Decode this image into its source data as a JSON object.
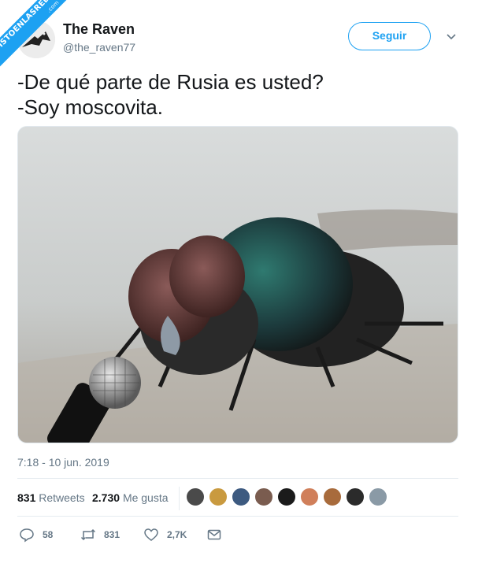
{
  "watermark": {
    "text": "VISTOENLASREDES",
    "sub": ".com"
  },
  "author": {
    "name": "The Raven",
    "handle": "@the_raven77"
  },
  "follow_button": {
    "label": "Seguir"
  },
  "tweet": {
    "line1": "-De qué parte de Rusia es usted?",
    "line2": "-Soy moscovita."
  },
  "timestamp": "7:18 - 10 jun. 2019",
  "stats": {
    "retweets_count": "831",
    "retweets_label": "Retweets",
    "likes_count": "2.730",
    "likes_label": "Me gusta"
  },
  "liker_avatars": [
    "#4a4a4a",
    "#c99a3f",
    "#3d5a80",
    "#7a5c4f",
    "#1b1b1b",
    "#d07f5a",
    "#a86b3c",
    "#2b2b2b",
    "#8a9aa6"
  ],
  "actions": {
    "replies": "58",
    "retweets": "831",
    "likes": "2,7K"
  },
  "colors": {
    "accent": "#1da1f2",
    "muted": "#657786",
    "text": "#14171a"
  }
}
